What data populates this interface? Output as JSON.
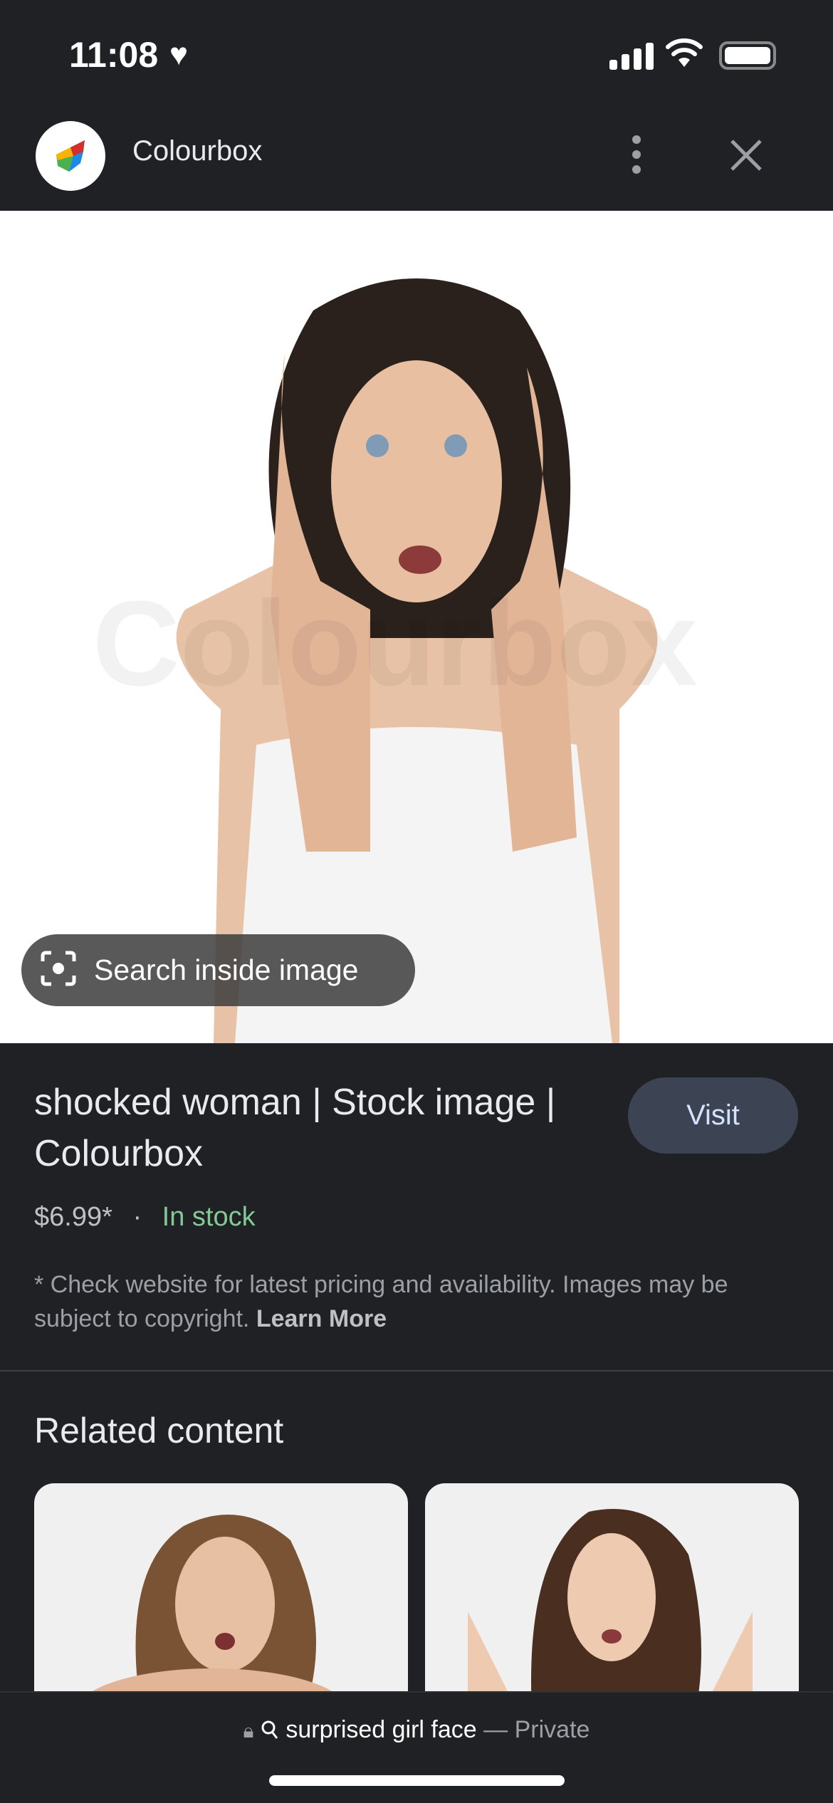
{
  "status_bar": {
    "time": "11:08",
    "heart_icon": "heart-icon",
    "signal_icon": "cellular-signal-icon",
    "wifi_icon": "wifi-icon",
    "battery_icon": "battery-icon"
  },
  "header": {
    "site_name": "Colourbox",
    "logo_icon": "colourbox-logo-icon",
    "more_icon": "more-vertical-icon",
    "close_icon": "close-icon"
  },
  "image": {
    "watermark": "Colourbox",
    "search_inside_label": "Search inside image"
  },
  "result": {
    "title": "shocked woman | Stock image | Colourbox",
    "visit_label": "Visit",
    "price": "$6.99*",
    "separator": "·",
    "availability": "In stock",
    "disclaimer": "* Check website for latest pricing and availability. Images may be subject to copyright.",
    "learn_more": "Learn More"
  },
  "related": {
    "heading": "Related content"
  },
  "bottom_bar": {
    "query": "surprised girl face",
    "dash": "—",
    "mode": "Private"
  },
  "colors": {
    "background": "#202124",
    "visit_button": "#3c4353",
    "in_stock": "#81c995"
  }
}
